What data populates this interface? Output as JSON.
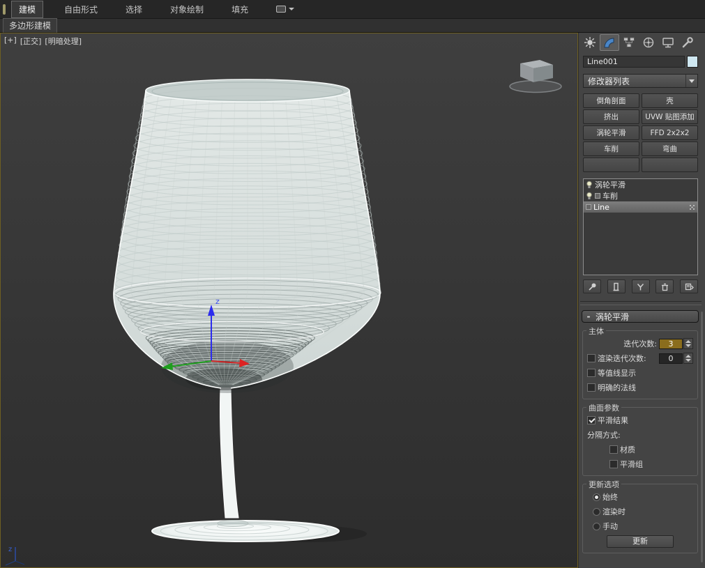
{
  "ribbon": {
    "tabs": [
      {
        "label": "建模"
      },
      {
        "label": "自由形式"
      },
      {
        "label": "选择"
      },
      {
        "label": "对象绘制"
      },
      {
        "label": "填充"
      }
    ],
    "subtab": "多边形建模"
  },
  "viewport": {
    "menu_plus": "[+]",
    "menu_view": "[正交]",
    "menu_shading": "[明暗处理]",
    "gizmo_axis_label": "z",
    "world_axis_label": "z"
  },
  "panel": {
    "object_name": "Line001",
    "modifier_list_label": "修改器列表",
    "modifier_buttons": [
      "倒角剖面",
      "壳",
      "挤出",
      "UVW 贴图添加",
      "涡轮平滑",
      "FFD 2x2x2",
      "车削",
      "弯曲",
      "",
      ""
    ],
    "stack_items": [
      {
        "label": "涡轮平滑"
      },
      {
        "label": "车削"
      },
      {
        "label": "Line"
      }
    ],
    "rollout": {
      "collapse_glyph": "-",
      "title": "涡轮平滑",
      "main_group": {
        "title": "主体",
        "iterations_label": "迭代次数:",
        "iterations_value": "3",
        "render_iterations_label": "渲染迭代次数:",
        "render_iterations_value": "0",
        "isoline_label": "等值线显示",
        "explicit_normals_label": "明确的法线"
      },
      "surface_group": {
        "title": "曲面参数",
        "smooth_result_label": "平滑结果",
        "separate_by_label": "分隔方式:",
        "materials_label": "材质",
        "smoothing_groups_label": "平滑组"
      },
      "update_group": {
        "title": "更新选项",
        "always_label": "始终",
        "when_rendering_label": "渲染时",
        "manually_label": "手动",
        "update_button_label": "更新"
      },
      "states": {
        "render_iterations_checked": false,
        "isoline_checked": false,
        "explicit_normals_checked": false,
        "smooth_result_checked": true,
        "materials_checked": false,
        "smoothing_groups_checked": false,
        "always_selected": true,
        "update_mode": "始终"
      }
    }
  },
  "colors": {
    "object_swatch": "#cfe7f1",
    "spinner_selection_highlight": "#8a6d1d",
    "viewport_border": "#6e5f22"
  }
}
